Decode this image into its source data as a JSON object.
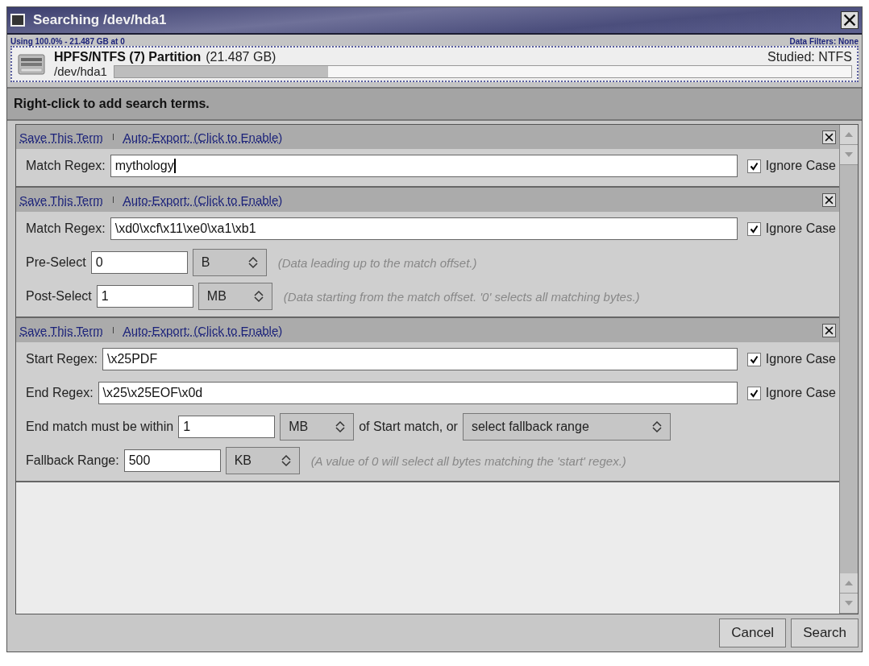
{
  "window": {
    "title": "Searching /dev/hda1"
  },
  "source": {
    "usage": "Using 100.0% - 21.487 GB at 0",
    "filters": "Data Filters: None",
    "name": "HPFS/NTFS (7) Partition",
    "size": "(21.487 GB)",
    "studied": "Studied: NTFS",
    "device": "/dev/hda1",
    "level": 0.29
  },
  "hint_bar": "Right-click to add search terms.",
  "terms": [
    {
      "save_link": "Save This Term",
      "export_link": "Auto-Export: (Click to Enable)",
      "rows": [
        {
          "kind": "regex",
          "label": "Match Regex:",
          "value": "mythology",
          "focused": true,
          "option": "Ignore Case",
          "checked": true
        }
      ]
    },
    {
      "save_link": "Save This Term",
      "export_link": "Auto-Export: (Click to Enable)",
      "rows": [
        {
          "kind": "regex",
          "label": "Match Regex:",
          "value": "\\xd0\\xcf\\x11\\xe0\\xa1\\xb1",
          "focused": false,
          "option": "Ignore Case",
          "checked": true
        },
        {
          "kind": "amount",
          "label": "Pre-Select",
          "value": "0",
          "unit": "B",
          "hint": "(Data leading up to the match offset.)"
        },
        {
          "kind": "amount",
          "label": "Post-Select",
          "value": "1",
          "unit": "MB",
          "hint": "(Data starting from the match offset.  '0' selects all matching bytes.)"
        }
      ]
    },
    {
      "save_link": "Save This Term",
      "export_link": "Auto-Export: (Click to Enable)",
      "rows": [
        {
          "kind": "regex",
          "label": "Start Regex:",
          "value": "\\x25PDF",
          "focused": false,
          "option": "Ignore Case",
          "checked": true
        },
        {
          "kind": "regex",
          "label": "End Regex:",
          "value": "\\x25\\x25EOF\\x0d",
          "focused": false,
          "option": "Ignore Case",
          "checked": true
        },
        {
          "kind": "within",
          "label": "End match must be within",
          "value": "1",
          "unit": "MB",
          "text": "of Start match, or",
          "choice": "select fallback range"
        },
        {
          "kind": "amount",
          "label": "Fallback Range:",
          "value": "500",
          "unit": "KB",
          "hint": "(A value of 0 will select all bytes matching the 'start' regex.)"
        }
      ]
    }
  ],
  "buttons": [
    "Cancel",
    "Search"
  ]
}
